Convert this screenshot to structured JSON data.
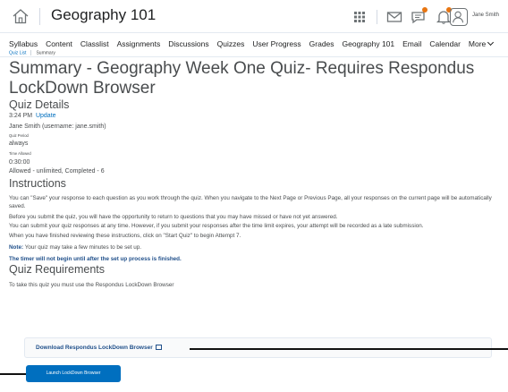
{
  "header": {
    "course_title": "Geography 101",
    "user_name": "Jane Smith"
  },
  "nav": {
    "items": [
      "Syllabus",
      "Content",
      "Classlist",
      "Assignments",
      "Discussions",
      "Quizzes",
      "User Progress",
      "Grades",
      "Geography 101",
      "Email",
      "Calendar",
      "More"
    ]
  },
  "breadcrumb": {
    "quiz_list": "Quiz List",
    "current": "Summary"
  },
  "page": {
    "title": "Summary - Geography Week One Quiz- Requires Respondus LockDown Browser",
    "quiz_details_heading": "Quiz Details",
    "time": "3:24 PM",
    "update_link": "Update",
    "user_line": "Jane Smith (username: jane.smith)",
    "quiz_period_label": "Quiz Period",
    "quiz_period_value": "always",
    "time_allowed_label": "Time Allowed",
    "time_allowed_value": "0:30:00",
    "attempts_line": "Allowed - unlimited, Completed - 6",
    "instructions_heading": "Instructions",
    "instr_1": "You can \"Save\" your response to each question as you work through the quiz. When you navigate to the Next Page or Previous Page, all your responses on the current page will be automatically saved.",
    "instr_2": "Before you submit the quiz, you will have the opportunity to return to questions that you may have missed or have not yet answered.",
    "instr_3": "You can submit your quiz responses at any time. However, if you submit your responses after the time limit expires, your attempt will be recorded as a late submission.",
    "instr_4": "When you have finished reviewing these instructions, click on \"Start Quiz\" to begin Attempt 7.",
    "note_label": "Note:",
    "note_text": " Your quiz may take a few minutes to be set up.",
    "timer_note": "The timer will not begin until after the set up process is finished.",
    "requirements_heading": "Quiz Requirements",
    "requirements_text": "To take this quiz you must use the Respondus LockDown Browser",
    "download_link": "Download Respondus LockDown Browser",
    "launch_button": "Launch LockDown Browser"
  },
  "colors": {
    "link": "#006fbf",
    "primary_button": "#006fbf",
    "notification_dot": "#e87511"
  }
}
